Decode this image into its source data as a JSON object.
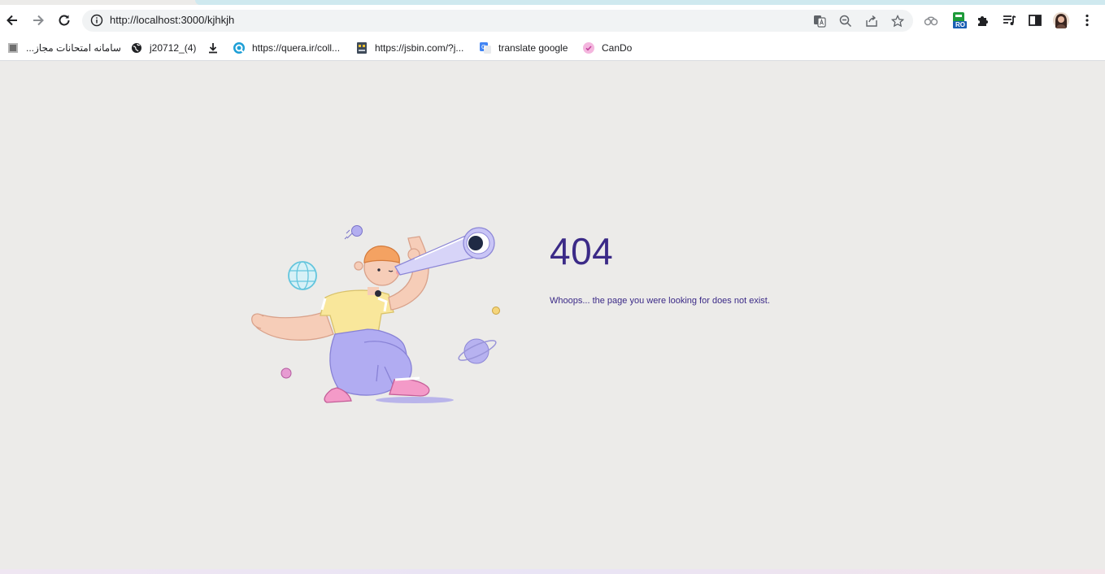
{
  "browser": {
    "url": "http://localhost:3000/kjhkjh",
    "extension_badge": "RO"
  },
  "bookmarks": [
    {
      "label": "سامانه امتحانات مجاز...",
      "icon": "exam-portal-icon"
    },
    {
      "label": "j20712_(4)",
      "icon": "globe-icon"
    },
    {
      "label": "",
      "icon": "download-icon"
    },
    {
      "label": "https://quera.ir/coll...",
      "icon": "quera-icon"
    },
    {
      "label": "https://jsbin.com/?j...",
      "icon": "jsbin-icon"
    },
    {
      "label": "translate google",
      "icon": "google-translate-icon"
    },
    {
      "label": "CanDo",
      "icon": "cando-icon"
    }
  ],
  "page": {
    "error_code": "404",
    "message": "Whoops... the page you were looking for does not exist."
  },
  "colors": {
    "accent": "#3b2a87",
    "background": "#ecebe9"
  }
}
